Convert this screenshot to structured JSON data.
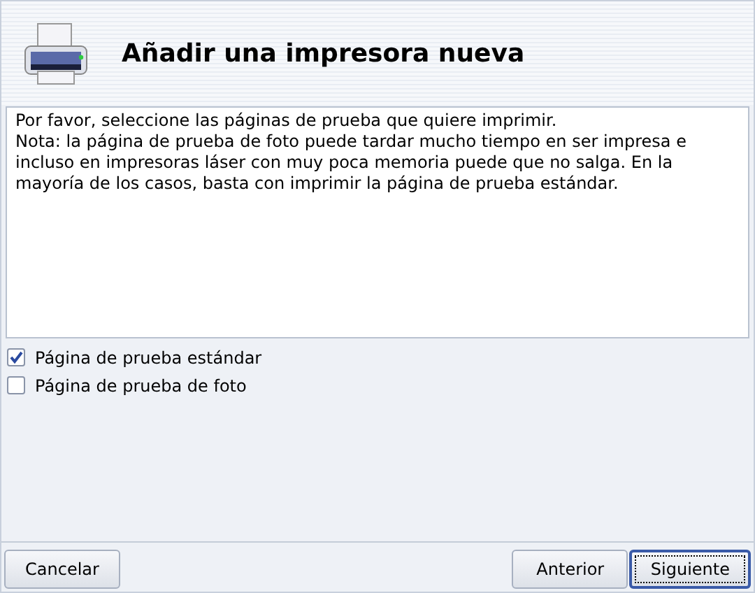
{
  "header": {
    "title": "Añadir una impresora nueva"
  },
  "description": [
    "Por favor, seleccione las páginas de prueba que quiere imprimir.",
    "Nota: la página de prueba de foto puede tardar mucho tiempo en ser impresa e incluso en impresoras láser con muy poca memoria puede que no salga. En la mayoría de los casos, basta con imprimir la página de prueba estándar."
  ],
  "options": [
    {
      "label": "Página de prueba estándar",
      "checked": true
    },
    {
      "label": "Página de prueba de foto",
      "checked": false
    }
  ],
  "buttons_left": [
    {
      "label": "Cancelar",
      "default": false
    }
  ],
  "buttons_right": [
    {
      "label": "Anterior",
      "default": false
    },
    {
      "label": "Siguiente",
      "default": true
    }
  ]
}
